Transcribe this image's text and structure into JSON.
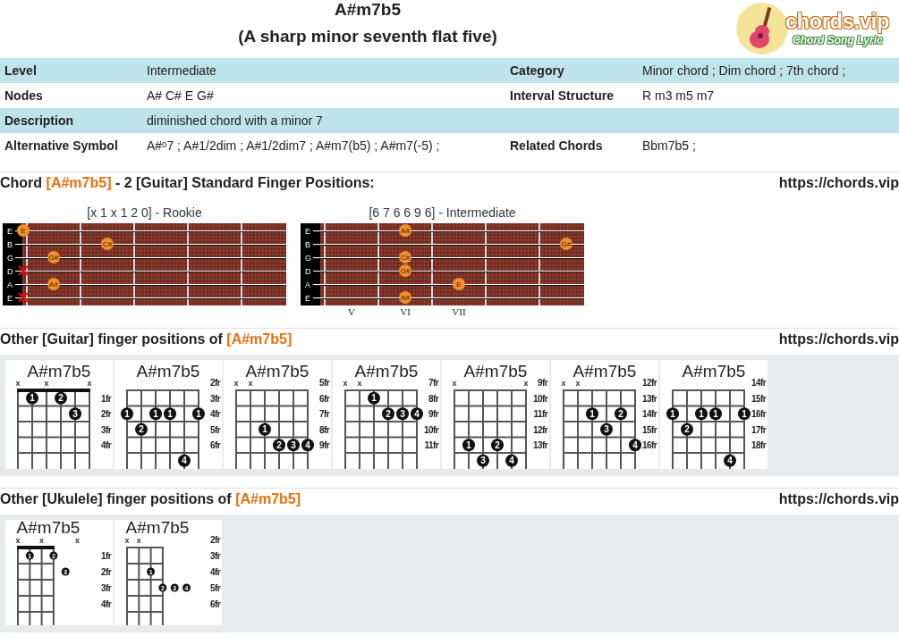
{
  "header": {
    "title": "A#m7b5",
    "subtitle": "(A sharp minor seventh flat five)",
    "logo": {
      "name": "chords.vip",
      "tagline": "Chord Song Lyric"
    }
  },
  "info_rows": [
    {
      "label": "Level",
      "value": "Intermediate",
      "label_2": "Category",
      "value_2": "Minor chord ; Dim chord ; 7th chord ;",
      "shaded": true
    },
    {
      "label": "Nodes",
      "value": "A# C# E G#",
      "label_2": "Interval Structure",
      "value_2": "R m3 m5 m7",
      "shaded": false
    },
    {
      "label": "Description",
      "value": "diminished chord with a minor 7",
      "shaded": true
    },
    {
      "label": "Alternative Symbol",
      "value": "A#ᵒ7 ; A#1/2dim ; A#1/2dim7 ; A#m7(b5) ; A#m7(-5) ;",
      "label_2": "Related Chords",
      "value_2": "Bbm7b5 ;",
      "shaded": false
    }
  ],
  "sections": [
    {
      "kind": "fretboards",
      "title": {
        "prefix": "Chord ",
        "highlight": "[A#m7b5]",
        "suffix": " - 2 [Guitar] Standard Finger Positions:"
      },
      "link": "https://chords.vip",
      "fretboards": [
        {
          "caption": "[x 1 x 1 2 0] - Rookie",
          "strings": [
            {
              "name": "E",
              "muted": false,
              "positions": [
                {
                  "kind": "dot",
                  "note": "E"
                },
                {
                  "kind": "open"
                },
                {
                  "kind": "open"
                },
                {
                  "kind": "open"
                },
                {
                  "kind": "open"
                },
                {
                  "kind": "open"
                }
              ]
            },
            {
              "name": "B",
              "muted": false,
              "positions": [
                {
                  "kind": "open"
                },
                {
                  "kind": "open"
                },
                {
                  "kind": "dot",
                  "note": "C#"
                },
                {
                  "kind": "open"
                },
                {
                  "kind": "open"
                },
                {
                  "kind": "open"
                }
              ]
            },
            {
              "name": "G",
              "muted": false,
              "positions": [
                {
                  "kind": "open"
                },
                {
                  "kind": "dot",
                  "note": "G#"
                },
                {
                  "kind": "open"
                },
                {
                  "kind": "open"
                },
                {
                  "kind": "open"
                },
                {
                  "kind": "open"
                }
              ]
            },
            {
              "name": "D",
              "muted": true
            },
            {
              "name": "A",
              "muted": false,
              "positions": [
                {
                  "kind": "open"
                },
                {
                  "kind": "dot",
                  "note": "A#"
                },
                {
                  "kind": "open"
                },
                {
                  "kind": "open"
                },
                {
                  "kind": "open"
                },
                {
                  "kind": "open"
                }
              ]
            },
            {
              "name": "E",
              "muted": true
            }
          ]
        },
        {
          "caption": "[6 7 6 6 9 6] - Intermediate",
          "position_marks": [
            "V",
            "VI",
            "VII"
          ],
          "strings": [
            {
              "name": "E",
              "muted": false,
              "positions": [
                {
                  "kind": "open"
                },
                {
                  "kind": "open"
                },
                {
                  "kind": "dot",
                  "note": "A#"
                },
                {
                  "kind": "open"
                },
                {
                  "kind": "open"
                },
                {
                  "kind": "open"
                }
              ]
            },
            {
              "name": "B",
              "muted": false,
              "positions": [
                {
                  "kind": "open"
                },
                {
                  "kind": "open"
                },
                {
                  "kind": "open"
                },
                {
                  "kind": "open"
                },
                {
                  "kind": "open"
                },
                {
                  "kind": "dot",
                  "note": "G#"
                }
              ]
            },
            {
              "name": "G",
              "muted": false,
              "positions": [
                {
                  "kind": "open"
                },
                {
                  "kind": "open"
                },
                {
                  "kind": "dot",
                  "note": "C#"
                },
                {
                  "kind": "open"
                },
                {
                  "kind": "open"
                },
                {
                  "kind": "open"
                }
              ]
            },
            {
              "name": "D",
              "muted": false,
              "positions": [
                {
                  "kind": "open"
                },
                {
                  "kind": "open"
                },
                {
                  "kind": "dot",
                  "note": "G#"
                },
                {
                  "kind": "open"
                },
                {
                  "kind": "open"
                },
                {
                  "kind": "open"
                }
              ]
            },
            {
              "name": "A",
              "muted": false,
              "positions": [
                {
                  "kind": "open"
                },
                {
                  "kind": "open"
                },
                {
                  "kind": "open"
                },
                {
                  "kind": "dot",
                  "note": "E"
                },
                {
                  "kind": "open"
                },
                {
                  "kind": "open"
                }
              ]
            },
            {
              "name": "E",
              "muted": false,
              "positions": [
                {
                  "kind": "open"
                },
                {
                  "kind": "open"
                },
                {
                  "kind": "dot",
                  "note": "A#"
                },
                {
                  "kind": "open"
                },
                {
                  "kind": "open"
                },
                {
                  "kind": "open"
                }
              ]
            }
          ]
        }
      ]
    },
    {
      "kind": "guitar-boxes",
      "title": {
        "prefix": "Other [Guitar] finger positions of ",
        "highlight": "[A#m7b5]"
      },
      "link": "https://chords.vip",
      "diagrams": [
        {
          "name": "A#m7b5",
          "nut": true,
          "mutes": [
            {
              "kind": "muted",
              "text": "x"
            },
            {
              "kind": "open"
            },
            {
              "kind": "muted",
              "text": "x"
            },
            {
              "kind": "open"
            },
            {
              "kind": "open"
            },
            {
              "kind": "muted",
              "text": "x"
            }
          ],
          "frets": [
            {
              "label": "1fr",
              "strings": [
                {
                  "kind": "open"
                },
                {
                  "kind": "dot",
                  "finger": "1"
                },
                {
                  "kind": "open"
                },
                {
                  "kind": "dot",
                  "finger": "2"
                },
                {
                  "kind": "open"
                },
                {
                  "kind": "open"
                }
              ]
            },
            {
              "label": "2fr",
              "strings": [
                {
                  "kind": "open"
                },
                {
                  "kind": "open"
                },
                {
                  "kind": "open"
                },
                {
                  "kind": "open"
                },
                {
                  "kind": "dot",
                  "finger": "3"
                },
                {
                  "kind": "open"
                }
              ]
            },
            {
              "label": "3fr",
              "strings": [
                {
                  "kind": "open"
                },
                {
                  "kind": "open"
                },
                {
                  "kind": "open"
                },
                {
                  "kind": "open"
                },
                {
                  "kind": "open"
                },
                {
                  "kind": "open"
                }
              ]
            },
            {
              "label": "4fr",
              "strings": [
                {
                  "kind": "open"
                },
                {
                  "kind": "open"
                },
                {
                  "kind": "open"
                },
                {
                  "kind": "open"
                },
                {
                  "kind": "open"
                },
                {
                  "kind": "open"
                }
              ]
            },
            {
              "strings": [
                {
                  "kind": "open"
                },
                {
                  "kind": "open"
                },
                {
                  "kind": "open"
                },
                {
                  "kind": "open"
                },
                {
                  "kind": "open"
                },
                {
                  "kind": "open"
                }
              ]
            }
          ]
        },
        {
          "name": "A#m7b5",
          "nut": false,
          "top_label": "2fr",
          "frets": [
            {
              "label": "3fr",
              "strings": [
                {
                  "kind": "open"
                },
                {
                  "kind": "open"
                },
                {
                  "kind": "open"
                },
                {
                  "kind": "open"
                },
                {
                  "kind": "open"
                },
                {
                  "kind": "open"
                }
              ]
            },
            {
              "label": "4fr",
              "strings": [
                {
                  "kind": "dot",
                  "finger": "1"
                },
                {
                  "kind": "open"
                },
                {
                  "kind": "dot",
                  "finger": "1"
                },
                {
                  "kind": "dot",
                  "finger": "1"
                },
                {
                  "kind": "open"
                },
                {
                  "kind": "dot",
                  "finger": "1"
                }
              ]
            },
            {
              "label": "5fr",
              "strings": [
                {
                  "kind": "open"
                },
                {
                  "kind": "dot",
                  "finger": "2"
                },
                {
                  "kind": "open"
                },
                {
                  "kind": "open"
                },
                {
                  "kind": "open"
                },
                {
                  "kind": "open"
                }
              ]
            },
            {
              "label": "6fr",
              "strings": [
                {
                  "kind": "open"
                },
                {
                  "kind": "open"
                },
                {
                  "kind": "open"
                },
                {
                  "kind": "open"
                },
                {
                  "kind": "open"
                },
                {
                  "kind": "open"
                }
              ]
            },
            {
              "strings": [
                {
                  "kind": "open"
                },
                {
                  "kind": "open"
                },
                {
                  "kind": "open"
                },
                {
                  "kind": "open"
                },
                {
                  "kind": "dot",
                  "finger": "4"
                },
                {
                  "kind": "open"
                }
              ]
            }
          ]
        },
        {
          "name": "A#m7b5",
          "nut": false,
          "top_label": "5fr",
          "mutes": [
            {
              "kind": "muted",
              "text": "x"
            },
            {
              "kind": "muted",
              "text": "x"
            },
            {
              "kind": "open"
            },
            {
              "kind": "open"
            },
            {
              "kind": "open"
            },
            {
              "kind": "open"
            }
          ],
          "frets": [
            {
              "label": "6fr",
              "strings": [
                {
                  "kind": "open"
                },
                {
                  "kind": "open"
                },
                {
                  "kind": "open"
                },
                {
                  "kind": "open"
                },
                {
                  "kind": "open"
                },
                {
                  "kind": "open"
                }
              ]
            },
            {
              "label": "7fr",
              "strings": [
                {
                  "kind": "open"
                },
                {
                  "kind": "open"
                },
                {
                  "kind": "open"
                },
                {
                  "kind": "open"
                },
                {
                  "kind": "open"
                },
                {
                  "kind": "open"
                }
              ]
            },
            {
              "label": "8fr",
              "strings": [
                {
                  "kind": "open"
                },
                {
                  "kind": "open"
                },
                {
                  "kind": "dot",
                  "finger": "1"
                },
                {
                  "kind": "open"
                },
                {
                  "kind": "open"
                },
                {
                  "kind": "open"
                }
              ]
            },
            {
              "label": "9fr",
              "strings": [
                {
                  "kind": "open"
                },
                {
                  "kind": "open"
                },
                {
                  "kind": "open"
                },
                {
                  "kind": "dot",
                  "finger": "2"
                },
                {
                  "kind": "dot",
                  "finger": "3"
                },
                {
                  "kind": "dot",
                  "finger": "4"
                }
              ]
            },
            {
              "strings": [
                {
                  "kind": "open"
                },
                {
                  "kind": "open"
                },
                {
                  "kind": "open"
                },
                {
                  "kind": "open"
                },
                {
                  "kind": "open"
                },
                {
                  "kind": "open"
                }
              ]
            }
          ]
        },
        {
          "name": "A#m7b5",
          "nut": false,
          "top_label": "7fr",
          "mutes": [
            {
              "kind": "muted",
              "text": "x"
            },
            {
              "kind": "muted",
              "text": "x"
            },
            {
              "kind": "open"
            },
            {
              "kind": "open"
            },
            {
              "kind": "open"
            },
            {
              "kind": "open"
            }
          ],
          "frets": [
            {
              "label": "8fr",
              "strings": [
                {
                  "kind": "open"
                },
                {
                  "kind": "open"
                },
                {
                  "kind": "dot",
                  "finger": "1"
                },
                {
                  "kind": "open"
                },
                {
                  "kind": "open"
                },
                {
                  "kind": "open"
                }
              ]
            },
            {
              "label": "9fr",
              "strings": [
                {
                  "kind": "open"
                },
                {
                  "kind": "open"
                },
                {
                  "kind": "open"
                },
                {
                  "kind": "dot",
                  "finger": "2"
                },
                {
                  "kind": "dot",
                  "finger": "3"
                },
                {
                  "kind": "dot",
                  "finger": "4"
                }
              ]
            },
            {
              "label": "10fr",
              "strings": [
                {
                  "kind": "open"
                },
                {
                  "kind": "open"
                },
                {
                  "kind": "open"
                },
                {
                  "kind": "open"
                },
                {
                  "kind": "open"
                },
                {
                  "kind": "open"
                }
              ]
            },
            {
              "label": "11fr",
              "strings": [
                {
                  "kind": "open"
                },
                {
                  "kind": "open"
                },
                {
                  "kind": "open"
                },
                {
                  "kind": "open"
                },
                {
                  "kind": "open"
                },
                {
                  "kind": "open"
                }
              ]
            },
            {
              "strings": [
                {
                  "kind": "open"
                },
                {
                  "kind": "open"
                },
                {
                  "kind": "open"
                },
                {
                  "kind": "open"
                },
                {
                  "kind": "open"
                },
                {
                  "kind": "open"
                }
              ]
            }
          ]
        },
        {
          "name": "A#m7b5",
          "nut": false,
          "top_label": "9fr",
          "mutes": [
            {
              "kind": "muted",
              "text": "x"
            },
            {
              "kind": "open"
            },
            {
              "kind": "open"
            },
            {
              "kind": "open"
            },
            {
              "kind": "open"
            },
            {
              "kind": "muted",
              "text": "x"
            }
          ],
          "frets": [
            {
              "label": "10fr",
              "strings": [
                {
                  "kind": "open"
                },
                {
                  "kind": "open"
                },
                {
                  "kind": "open"
                },
                {
                  "kind": "open"
                },
                {
                  "kind": "open"
                },
                {
                  "kind": "open"
                }
              ]
            },
            {
              "label": "11fr",
              "strings": [
                {
                  "kind": "open"
                },
                {
                  "kind": "open"
                },
                {
                  "kind": "open"
                },
                {
                  "kind": "open"
                },
                {
                  "kind": "open"
                },
                {
                  "kind": "open"
                }
              ]
            },
            {
              "label": "12fr",
              "strings": [
                {
                  "kind": "open"
                },
                {
                  "kind": "open"
                },
                {
                  "kind": "open"
                },
                {
                  "kind": "open"
                },
                {
                  "kind": "open"
                },
                {
                  "kind": "open"
                }
              ]
            },
            {
              "label": "13fr",
              "strings": [
                {
                  "kind": "open"
                },
                {
                  "kind": "dot",
                  "finger": "1"
                },
                {
                  "kind": "open"
                },
                {
                  "kind": "dot",
                  "finger": "2"
                },
                {
                  "kind": "open"
                },
                {
                  "kind": "open"
                }
              ]
            },
            {
              "strings": [
                {
                  "kind": "open"
                },
                {
                  "kind": "open"
                },
                {
                  "kind": "dot",
                  "finger": "3"
                },
                {
                  "kind": "open"
                },
                {
                  "kind": "dot",
                  "finger": "4"
                },
                {
                  "kind": "open"
                }
              ]
            }
          ]
        },
        {
          "name": "A#m7b5",
          "nut": false,
          "top_label": "12fr",
          "mutes": [
            {
              "kind": "muted",
              "text": "x"
            },
            {
              "kind": "muted",
              "text": "x"
            },
            {
              "kind": "open"
            },
            {
              "kind": "open"
            },
            {
              "kind": "open"
            },
            {
              "kind": "open"
            }
          ],
          "frets": [
            {
              "label": "13fr",
              "strings": [
                {
                  "kind": "open"
                },
                {
                  "kind": "open"
                },
                {
                  "kind": "open"
                },
                {
                  "kind": "open"
                },
                {
                  "kind": "open"
                },
                {
                  "kind": "open"
                }
              ]
            },
            {
              "label": "14fr",
              "strings": [
                {
                  "kind": "open"
                },
                {
                  "kind": "open"
                },
                {
                  "kind": "dot",
                  "finger": "1"
                },
                {
                  "kind": "open"
                },
                {
                  "kind": "dot",
                  "finger": "2"
                },
                {
                  "kind": "open"
                }
              ]
            },
            {
              "label": "15fr",
              "strings": [
                {
                  "kind": "open"
                },
                {
                  "kind": "open"
                },
                {
                  "kind": "open"
                },
                {
                  "kind": "dot",
                  "finger": "3"
                },
                {
                  "kind": "open"
                },
                {
                  "kind": "open"
                }
              ]
            },
            {
              "label": "16fr",
              "strings": [
                {
                  "kind": "open"
                },
                {
                  "kind": "open"
                },
                {
                  "kind": "open"
                },
                {
                  "kind": "open"
                },
                {
                  "kind": "open"
                },
                {
                  "kind": "dot",
                  "finger": "4"
                }
              ]
            },
            {
              "strings": [
                {
                  "kind": "open"
                },
                {
                  "kind": "open"
                },
                {
                  "kind": "open"
                },
                {
                  "kind": "open"
                },
                {
                  "kind": "open"
                },
                {
                  "kind": "open"
                }
              ]
            }
          ]
        },
        {
          "name": "A#m7b5",
          "nut": false,
          "top_label": "14fr",
          "frets": [
            {
              "label": "15fr",
              "strings": [
                {
                  "kind": "open"
                },
                {
                  "kind": "open"
                },
                {
                  "kind": "open"
                },
                {
                  "kind": "open"
                },
                {
                  "kind": "open"
                },
                {
                  "kind": "open"
                }
              ]
            },
            {
              "label": "16fr",
              "strings": [
                {
                  "kind": "dot",
                  "finger": "1"
                },
                {
                  "kind": "open"
                },
                {
                  "kind": "dot",
                  "finger": "1"
                },
                {
                  "kind": "dot",
                  "finger": "1"
                },
                {
                  "kind": "open"
                },
                {
                  "kind": "dot",
                  "finger": "1"
                }
              ]
            },
            {
              "label": "17fr",
              "strings": [
                {
                  "kind": "open"
                },
                {
                  "kind": "dot",
                  "finger": "2"
                },
                {
                  "kind": "open"
                },
                {
                  "kind": "open"
                },
                {
                  "kind": "open"
                },
                {
                  "kind": "open"
                }
              ]
            },
            {
              "label": "18fr",
              "strings": [
                {
                  "kind": "open"
                },
                {
                  "kind": "open"
                },
                {
                  "kind": "open"
                },
                {
                  "kind": "open"
                },
                {
                  "kind": "open"
                },
                {
                  "kind": "open"
                }
              ]
            },
            {
              "strings": [
                {
                  "kind": "open"
                },
                {
                  "kind": "open"
                },
                {
                  "kind": "open"
                },
                {
                  "kind": "open"
                },
                {
                  "kind": "dot",
                  "finger": "4"
                },
                {
                  "kind": "open"
                }
              ]
            }
          ]
        }
      ]
    },
    {
      "kind": "ukulele-boxes",
      "title": {
        "prefix": "Other [Ukulele] finger positions of ",
        "highlight": "[A#m7b5]"
      },
      "link": "https://chords.vip",
      "diagrams": [
        {
          "name": "A#m7b5",
          "nut": true,
          "mutes": [
            {
              "kind": "muted",
              "text": "x"
            },
            {
              "kind": "open"
            },
            {
              "kind": "muted",
              "text": "x"
            },
            {
              "kind": "open"
            },
            {
              "kind": "open"
            },
            {
              "kind": "muted",
              "text": "x"
            }
          ],
          "frets": [
            {
              "label": "1fr",
              "strings": [
                {
                  "kind": "open"
                },
                {
                  "kind": "dot",
                  "finger": "1"
                },
                {
                  "kind": "open"
                },
                {
                  "kind": "dot",
                  "finger": "2"
                },
                {
                  "kind": "open"
                },
                {
                  "kind": "open"
                }
              ]
            },
            {
              "label": "2fr",
              "strings": [
                {
                  "kind": "open"
                },
                {
                  "kind": "open"
                },
                {
                  "kind": "open"
                },
                {
                  "kind": "open"
                },
                {
                  "kind": "dot",
                  "finger": "3"
                },
                {
                  "kind": "open"
                }
              ]
            },
            {
              "label": "3fr",
              "strings": [
                {
                  "kind": "open"
                },
                {
                  "kind": "open"
                },
                {
                  "kind": "open"
                },
                {
                  "kind": "open"
                },
                {
                  "kind": "open"
                },
                {
                  "kind": "open"
                }
              ]
            },
            {
              "label": "4fr",
              "strings": [
                {
                  "kind": "open"
                },
                {
                  "kind": "open"
                },
                {
                  "kind": "open"
                },
                {
                  "kind": "open"
                },
                {
                  "kind": "open"
                },
                {
                  "kind": "open"
                }
              ]
            },
            {
              "strings": [
                {
                  "kind": "open"
                },
                {
                  "kind": "open"
                },
                {
                  "kind": "open"
                },
                {
                  "kind": "open"
                },
                {
                  "kind": "open"
                },
                {
                  "kind": "open"
                }
              ]
            }
          ]
        },
        {
          "name": "A#m7b5",
          "nut": false,
          "top_label": "2fr",
          "mutes": [
            {
              "kind": "muted",
              "text": "x"
            },
            {
              "kind": "muted",
              "text": "x"
            },
            {
              "kind": "open"
            },
            {
              "kind": "open"
            },
            {
              "kind": "open"
            },
            {
              "kind": "open"
            }
          ],
          "frets": [
            {
              "label": "3fr",
              "strings": [
                {
                  "kind": "open"
                },
                {
                  "kind": "open"
                },
                {
                  "kind": "open"
                },
                {
                  "kind": "open"
                },
                {
                  "kind": "open"
                },
                {
                  "kind": "open"
                }
              ]
            },
            {
              "label": "4fr",
              "strings": [
                {
                  "kind": "open"
                },
                {
                  "kind": "open"
                },
                {
                  "kind": "dot",
                  "finger": "1"
                },
                {
                  "kind": "open"
                },
                {
                  "kind": "open"
                },
                {
                  "kind": "open"
                }
              ]
            },
            {
              "label": "5fr",
              "strings": [
                {
                  "kind": "open"
                },
                {
                  "kind": "open"
                },
                {
                  "kind": "open"
                },
                {
                  "kind": "dot",
                  "finger": "2"
                },
                {
                  "kind": "dot",
                  "finger": "3"
                },
                {
                  "kind": "dot",
                  "finger": "4"
                }
              ]
            },
            {
              "label": "6fr",
              "strings": [
                {
                  "kind": "open"
                },
                {
                  "kind": "open"
                },
                {
                  "kind": "open"
                },
                {
                  "kind": "open"
                },
                {
                  "kind": "open"
                },
                {
                  "kind": "open"
                }
              ]
            },
            {
              "strings": [
                {
                  "kind": "open"
                },
                {
                  "kind": "open"
                },
                {
                  "kind": "open"
                },
                {
                  "kind": "open"
                },
                {
                  "kind": "open"
                },
                {
                  "kind": "open"
                }
              ]
            }
          ]
        }
      ]
    }
  ]
}
